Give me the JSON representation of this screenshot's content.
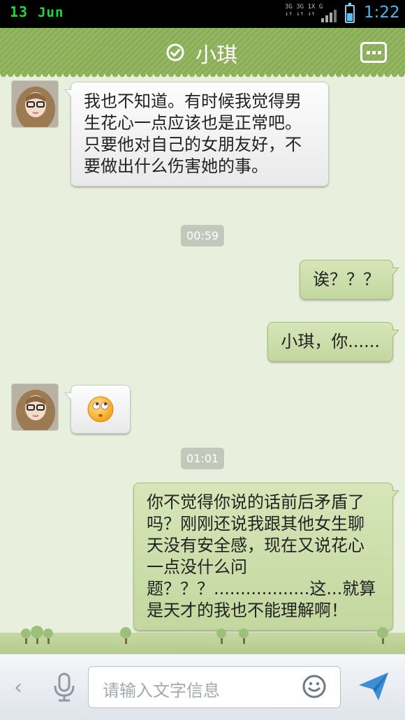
{
  "status_bar": {
    "day": "13",
    "month": "Jun",
    "network_top": "3G 3G 1X  G",
    "network_bottom": "↓↑ ↓↑ ↓↑",
    "time": "1:22",
    "battery_level": 0.45,
    "icons": [
      "signal-icon",
      "battery-icon"
    ]
  },
  "header": {
    "title": "小琪",
    "icons": [
      "check-circle-icon",
      "more-icon"
    ]
  },
  "messages": [
    {
      "type": "text",
      "side": "in",
      "text": "我也不知道。有时候我觉得男生花心一点应该也是正常吧。只要他对自己的女朋友好，不要做出什么伤害她的事。"
    },
    {
      "type": "time",
      "text": "00:59"
    },
    {
      "type": "text",
      "side": "out",
      "text": "诶？？？"
    },
    {
      "type": "text",
      "side": "out",
      "text": "小琪，你......"
    },
    {
      "type": "emoji",
      "side": "in",
      "emoji": "rolling-eyes-emoji"
    },
    {
      "type": "time",
      "text": "01:01"
    },
    {
      "type": "text",
      "side": "out",
      "text": "你不觉得你说的话前后矛盾了吗？刚刚还说我跟其他女生聊天没有安全感，现在又说花心一点没什么问题？？？..................这...就算是天才的我也不能理解啊！"
    }
  ],
  "input_bar": {
    "placeholder": "请输入文字信息",
    "icons": [
      "back-arrow-icon",
      "microphone-icon",
      "smiley-icon",
      "send-icon"
    ]
  },
  "colors": {
    "header": "#8fb25a",
    "incoming_bubble": "#f5f5f5",
    "outgoing_bubble": "#cddfae",
    "background": "#e8efdc",
    "clock": "#49b8f0",
    "date": "#22d63a"
  }
}
